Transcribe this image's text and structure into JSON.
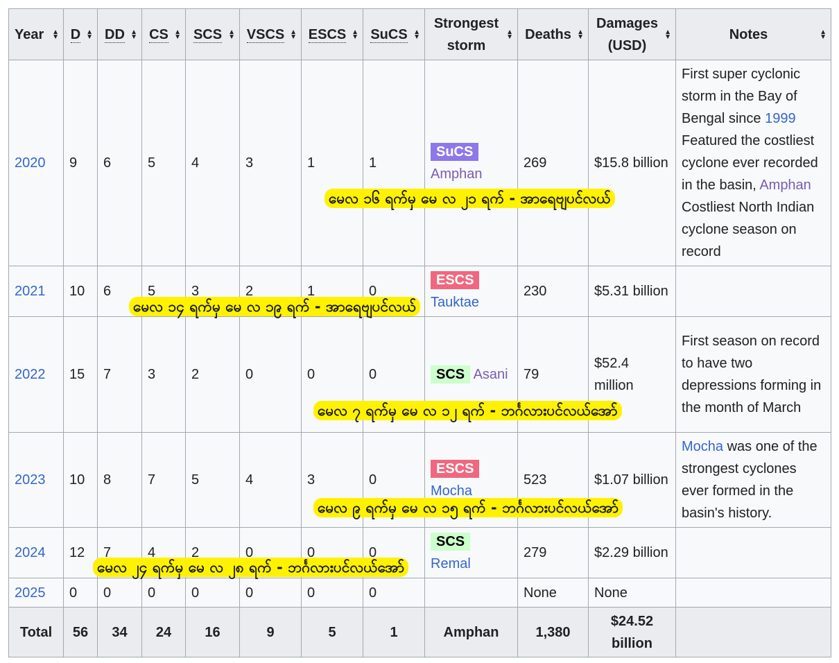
{
  "headers": [
    {
      "label": "Year",
      "abbr": false
    },
    {
      "label": "D",
      "abbr": true
    },
    {
      "label": "DD",
      "abbr": true
    },
    {
      "label": "CS",
      "abbr": true
    },
    {
      "label": "SCS",
      "abbr": true
    },
    {
      "label": "VSCS",
      "abbr": true
    },
    {
      "label": "ESCS",
      "abbr": true
    },
    {
      "label": "SuCS",
      "abbr": true
    },
    {
      "label": "Strongest storm",
      "abbr": false
    },
    {
      "label": "Deaths",
      "abbr": false
    },
    {
      "label": "Damages (USD)",
      "abbr": false
    },
    {
      "label": "Notes",
      "abbr": false
    }
  ],
  "rows": [
    {
      "year": "2020",
      "d": "9",
      "dd": "6",
      "cs": "5",
      "scs": "4",
      "vscs": "3",
      "escs": "1",
      "sucs": "1",
      "storm_badge": "SuCS",
      "storm_badge_color": "#8c78e8",
      "storm_name": "Amphan",
      "storm_visited": true,
      "badge_inline": false,
      "deaths": "269",
      "damages": "$15.8 billion",
      "notes_pre": "First super cyclonic storm in the Bay of Bengal since ",
      "notes_link1": "1999",
      "notes_mid": " Featured the costliest cyclone ever recorded in the basin, ",
      "notes_link2": "Amphan",
      "notes_post": " Costliest North Indian cyclone season on record"
    },
    {
      "year": "2021",
      "d": "10",
      "dd": "6",
      "cs": "5",
      "scs": "3",
      "vscs": "2",
      "escs": "1",
      "sucs": "0",
      "storm_badge": "ESCS",
      "storm_badge_color": "#f0677f",
      "storm_name": "Tauktae",
      "storm_visited": false,
      "badge_inline": false,
      "deaths": "230",
      "damages": "$5.31 billion",
      "notes_pre": "",
      "notes_link1": "",
      "notes_mid": "",
      "notes_link2": "",
      "notes_post": ""
    },
    {
      "year": "2022",
      "d": "15",
      "dd": "7",
      "cs": "3",
      "scs": "2",
      "vscs": "0",
      "escs": "0",
      "sucs": "0",
      "storm_badge": "SCS",
      "storm_badge_color": "#ccffcc",
      "storm_name": "Asani",
      "storm_visited": true,
      "badge_inline": true,
      "deaths": "79",
      "damages": "$52.4 million",
      "notes_pre": "First season on record to have two depressions forming in the month of March",
      "notes_link1": "",
      "notes_mid": "",
      "notes_link2": "",
      "notes_post": ""
    },
    {
      "year": "2023",
      "d": "10",
      "dd": "8",
      "cs": "7",
      "scs": "5",
      "vscs": "4",
      "escs": "3",
      "sucs": "0",
      "storm_badge": "ESCS",
      "storm_badge_color": "#f0677f",
      "storm_name": "Mocha",
      "storm_visited": false,
      "badge_inline": false,
      "deaths": "523",
      "damages": "$1.07 billion",
      "notes_pre": "",
      "notes_link1": "Mocha",
      "notes_mid": " was one of the strongest cyclones ever formed in the basin's history.",
      "notes_link2": "",
      "notes_post": ""
    },
    {
      "year": "2024",
      "d": "12",
      "dd": "7",
      "cs": "4",
      "scs": "2",
      "vscs": "0",
      "escs": "0",
      "sucs": "0",
      "storm_badge": "SCS",
      "storm_badge_color": "#ccffcc",
      "storm_name": "Remal",
      "storm_visited": false,
      "badge_inline": false,
      "deaths": "279",
      "damages": "$2.29 billion",
      "notes_pre": "",
      "notes_link1": "",
      "notes_mid": "",
      "notes_link2": "",
      "notes_post": ""
    },
    {
      "year": "2025",
      "d": "0",
      "dd": "0",
      "cs": "0",
      "scs": "0",
      "vscs": "0",
      "escs": "0",
      "sucs": "0",
      "storm_badge": "",
      "storm_badge_color": "",
      "storm_name": "",
      "storm_visited": false,
      "badge_inline": false,
      "deaths": "None",
      "damages": "None",
      "notes_pre": "",
      "notes_link1": "",
      "notes_mid": "",
      "notes_link2": "",
      "notes_post": ""
    }
  ],
  "total": {
    "label": "Total",
    "d": "56",
    "dd": "34",
    "cs": "24",
    "scs": "16",
    "vscs": "9",
    "escs": "5",
    "sucs": "1",
    "storm": "Amphan",
    "deaths": "1,380",
    "damages": "$24.52 billion"
  },
  "overlays": [
    "မေလ ၁၆ ရက်မှ မေ လ ၂၁ ရက် - အာရေဗျပင်လယ်",
    "မေလ ၁၄ ရက်မှ မေ လ ၁၉ ရက် - အာရေဗျပင်လယ်",
    "မေလ ၇ ရက်မှ မေ လ ၁၂ ရက် - ဘင်္ဂလားပင်လယ်အော်",
    "မေလ ၉ ရက်မှ မေ လ ၁၅ ရက် - ဘင်္ဂလားပင်လယ်အော်",
    "မေလ ၂၄ ရက်မှ မေ လ ၂၈ ရက် - ဘင်္ဂလားပင်လယ်အော်"
  ]
}
